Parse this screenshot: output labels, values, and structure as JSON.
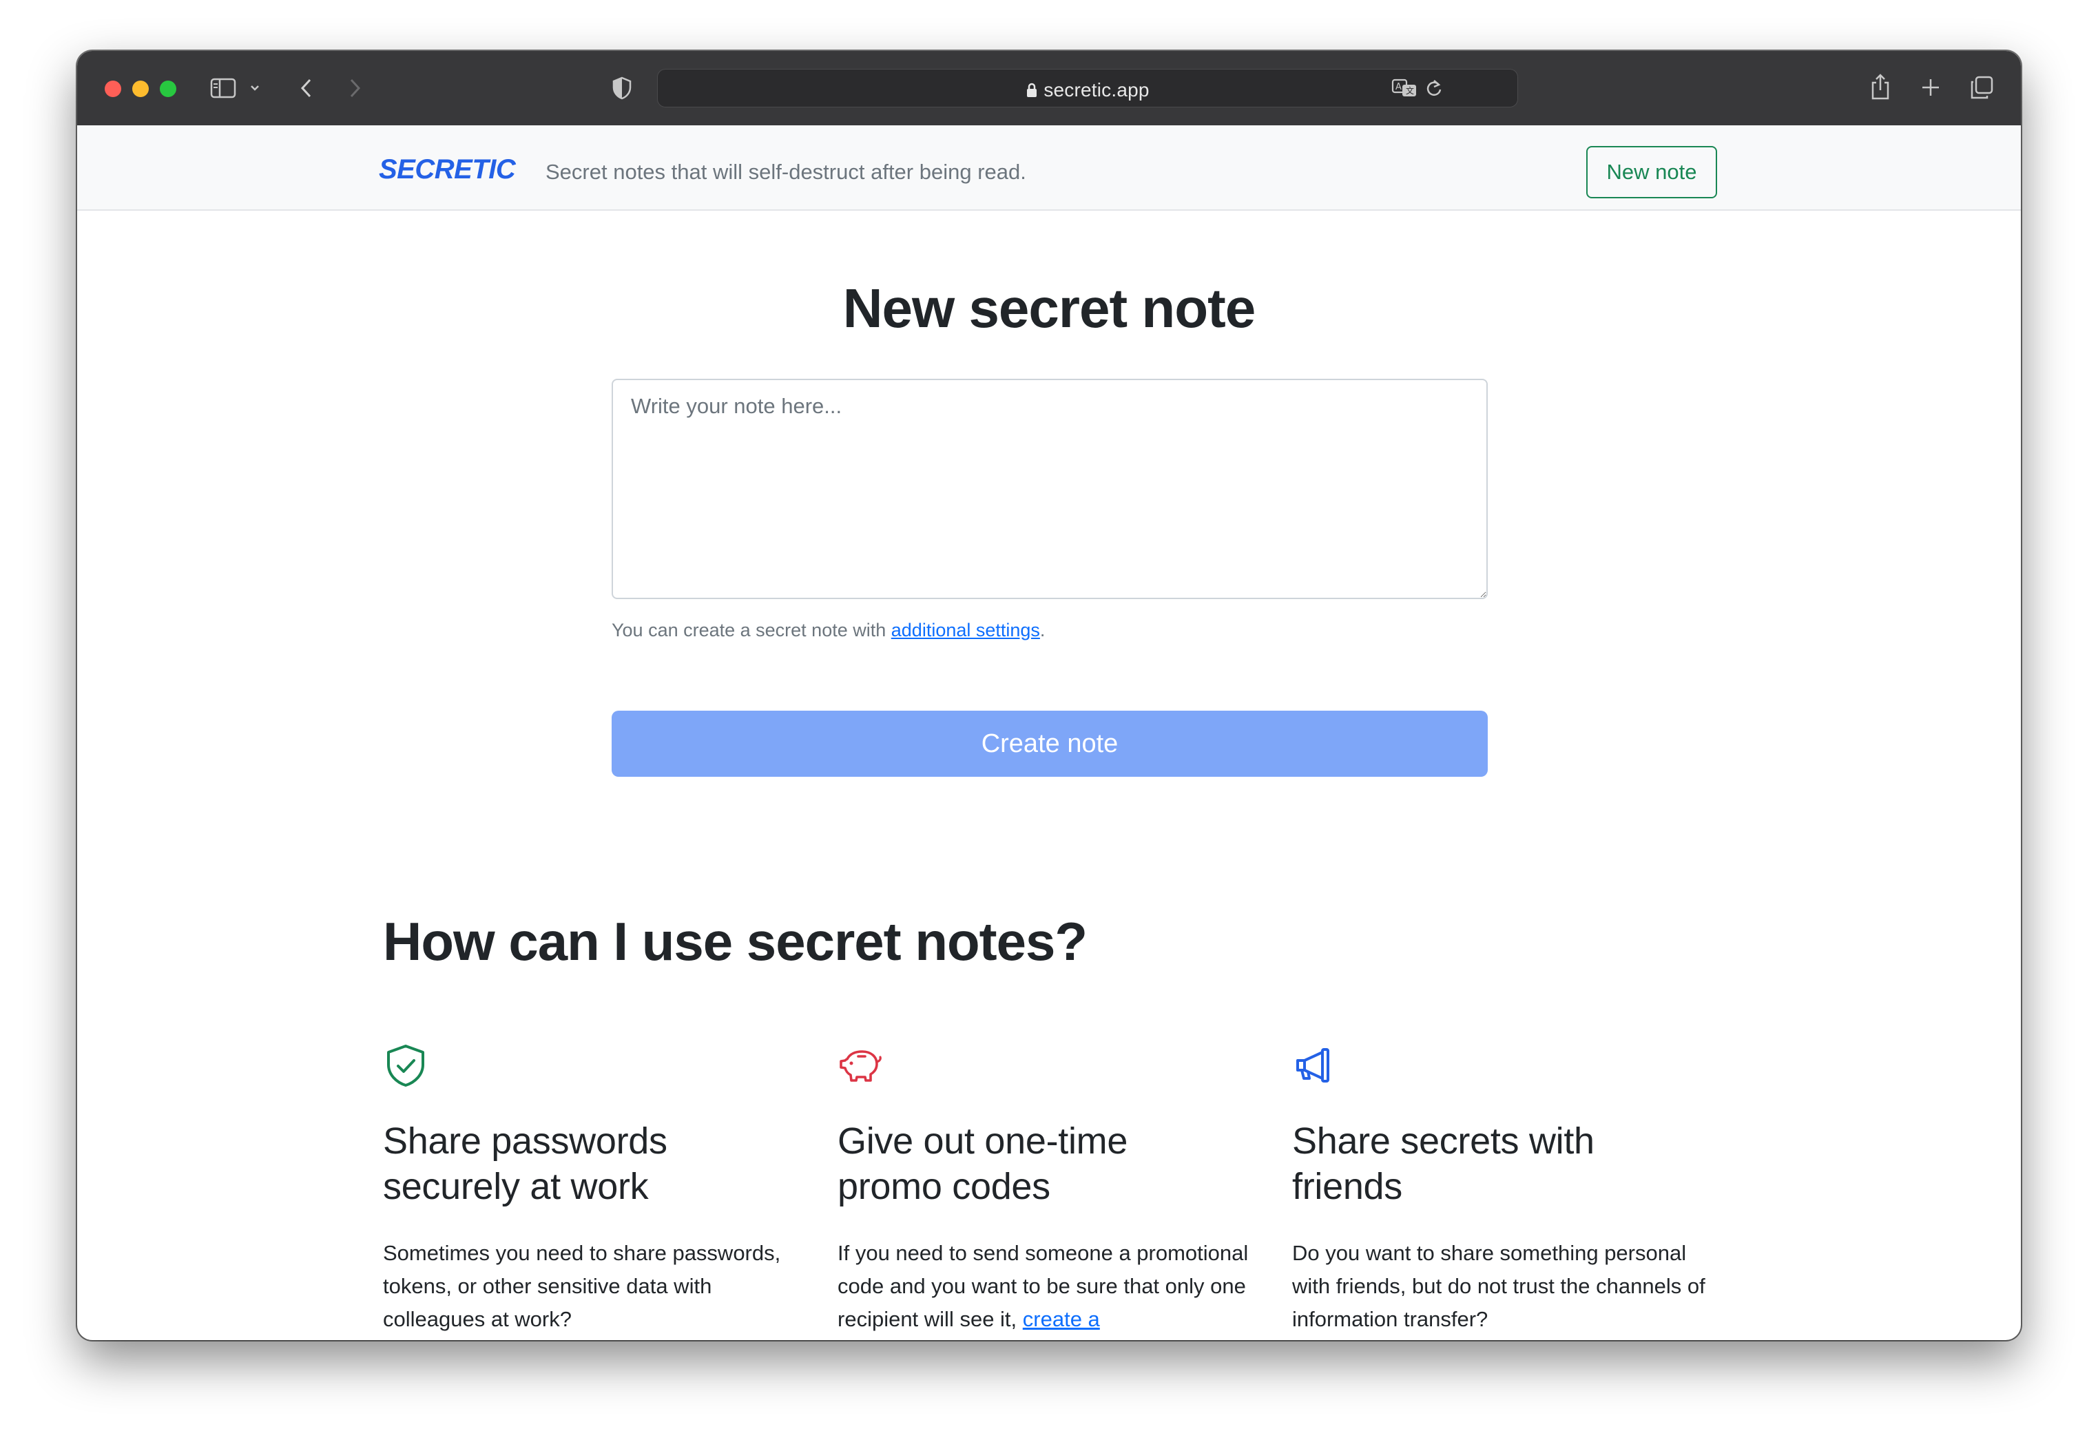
{
  "browser": {
    "url": "secretic.app"
  },
  "header": {
    "logo": "SECRETIC",
    "tagline": "Secret notes that will self-destruct after being read.",
    "new_note_label": "New note"
  },
  "main": {
    "title": "New secret note",
    "note_placeholder": "Write your note here...",
    "help_prefix": "You can create a secret note with ",
    "help_link": "additional settings",
    "help_suffix": ".",
    "create_label": "Create note"
  },
  "section": {
    "title": "How can I use secret notes?"
  },
  "features": [
    {
      "icon": "shield-check-icon",
      "title_line1": "Share passwords",
      "title_line2": "securely at work",
      "text": "Sometimes you need to share passwords, tokens, or other sensitive data with colleagues at work?"
    },
    {
      "icon": "piggy-bank-icon",
      "title_line1": "Give out one-time",
      "title_line2": "promo codes",
      "text": "If you need to send someone a promotional code and you want to be sure that only one recipient will see it, ",
      "link": "create a"
    },
    {
      "icon": "megaphone-icon",
      "title_line1": "Share secrets with",
      "title_line2": "friends",
      "text": "Do you want to share something personal with friends, but do not trust the channels of information transfer?"
    }
  ],
  "colors": {
    "brand": "#2461e6",
    "success": "#198754",
    "primary_disabled": "#7ea6f8",
    "danger": "#dc3545",
    "link": "#0d6efd"
  }
}
